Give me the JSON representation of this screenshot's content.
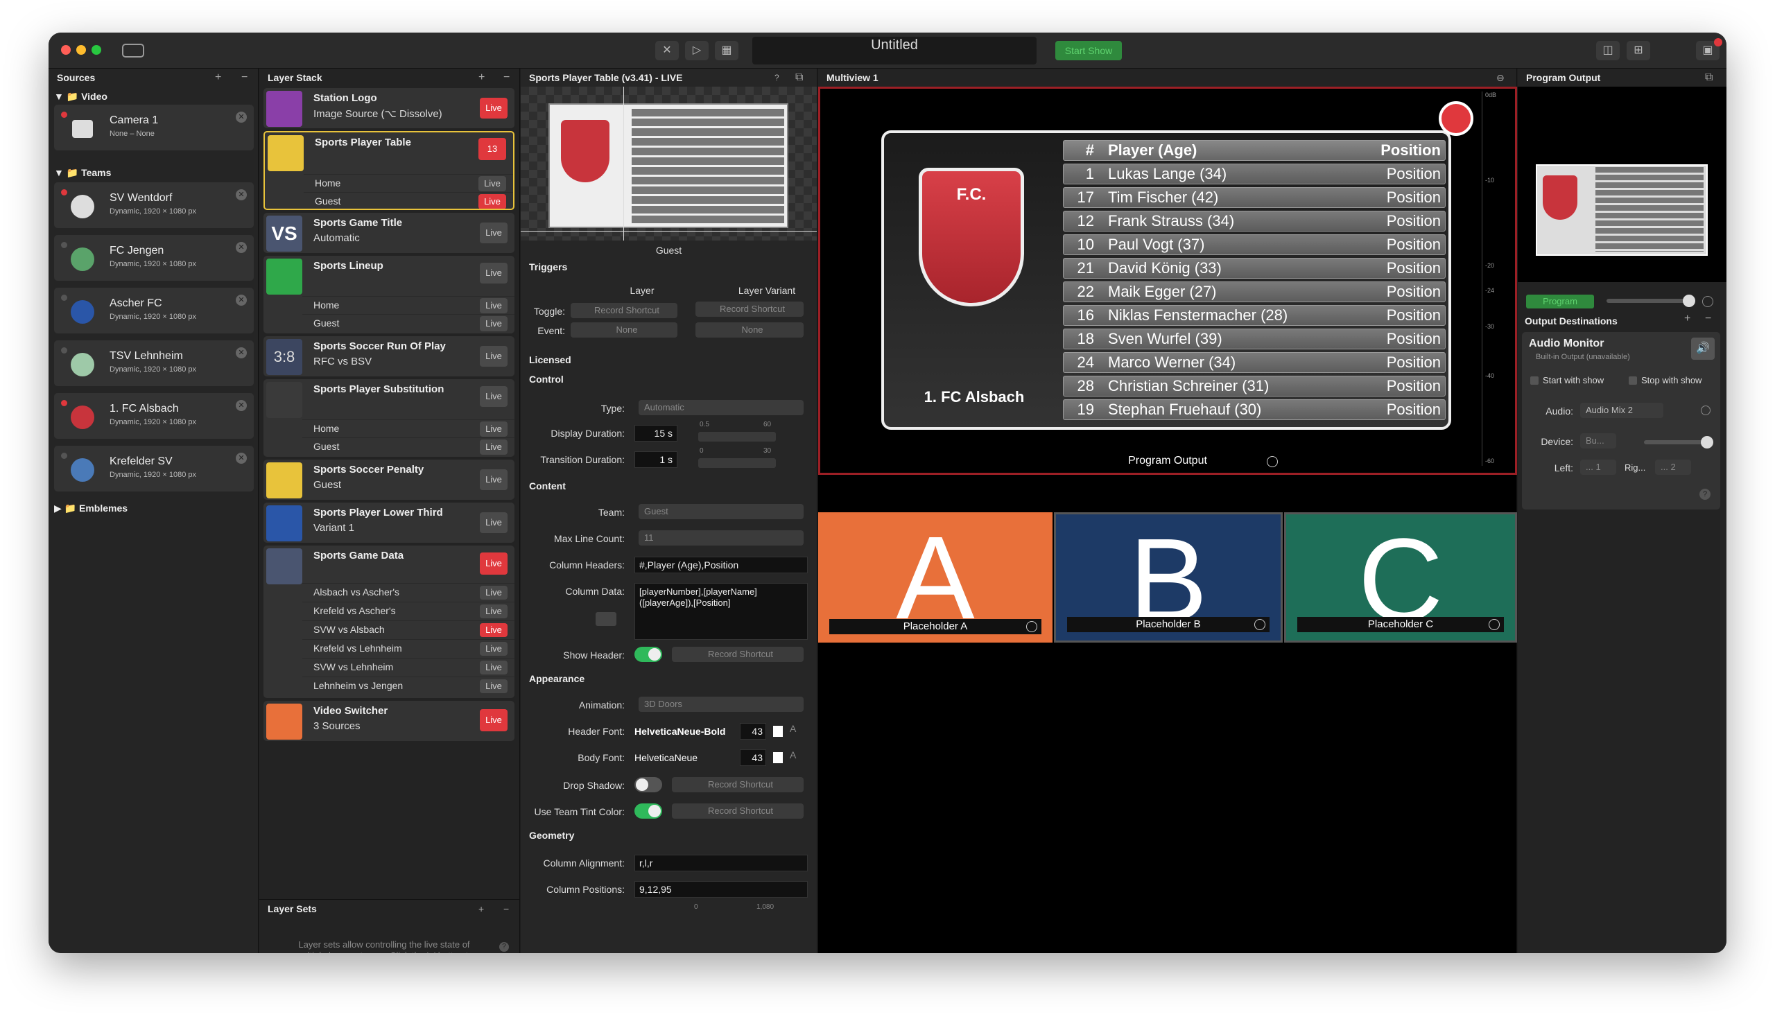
{
  "window": {
    "title": "Untitled",
    "start_show": "Start Show"
  },
  "sources": {
    "header": "Sources",
    "groups": {
      "video": "Video",
      "teams": "Teams",
      "emblemes": "Emblemes"
    },
    "items": [
      {
        "name": "Camera 1",
        "sub": "None – None"
      },
      {
        "name": "SV Wentdorf",
        "sub": "Dynamic, 1920 × 1080 px"
      },
      {
        "name": "FC Jengen",
        "sub": "Dynamic, 1920 × 1080 px"
      },
      {
        "name": "Ascher FC",
        "sub": "Dynamic, 1920 × 1080 px"
      },
      {
        "name": "TSV Lehnheim",
        "sub": "Dynamic, 1920 × 1080 px"
      },
      {
        "name": "1. FC Alsbach",
        "sub": "Dynamic, 1920 × 1080 px"
      },
      {
        "name": "Krefelder SV",
        "sub": "Dynamic, 1920 × 1080 px"
      }
    ]
  },
  "layers": {
    "header": "Layer Stack",
    "live": "Live",
    "items": [
      {
        "name": "Station Logo",
        "sub": "Image Source (⌥ Dissolve)"
      },
      {
        "name": "Sports Player Table",
        "badge": "13",
        "variants": [
          "Home",
          "Guest"
        ]
      },
      {
        "name": "Sports Game Title",
        "sub": "Automatic"
      },
      {
        "name": "Sports Lineup",
        "variants": [
          "Home",
          "Guest"
        ]
      },
      {
        "name": "Sports Soccer Run Of Play",
        "sub": "RFC vs BSV"
      },
      {
        "name": "Sports Player Substitution",
        "variants": [
          "Home",
          "Guest"
        ]
      },
      {
        "name": "Sports Soccer Penalty",
        "sub": "Guest"
      },
      {
        "name": "Sports Player Lower Third",
        "sub": "Variant 1"
      },
      {
        "name": "Sports Game Data",
        "variants": [
          "Alsbach vs Ascher's",
          "Krefeld vs Ascher's",
          "SVW vs Alsbach",
          "Krefeld vs Lehnheim",
          "SVW vs Lehnheim",
          "Lehnheim vs Jengen"
        ]
      },
      {
        "name": "Video Switcher",
        "sub": "3 Sources"
      }
    ],
    "layer_sets_header": "Layer Sets",
    "layer_sets_help": "Layer sets allow controlling the live state of multiple layers at once. Click the '+' button to capture the current layer stack in a new layer set."
  },
  "inspector": {
    "header": "Sports Player Table (v3.41) - LIVE",
    "variant": "Guest",
    "triggers": "Triggers",
    "layer": "Layer",
    "layer_variant": "Layer Variant",
    "toggle_label": "Toggle:",
    "event_label": "Event:",
    "record_shortcut": "Record Shortcut",
    "none": "None",
    "licensed": "Licensed",
    "control": "Control",
    "type_label": "Type:",
    "type_value": "Automatic",
    "display_duration_label": "Display Duration:",
    "display_duration": "15 s",
    "transition_duration_label": "Transition Duration:",
    "transition_duration": "1 s",
    "content": "Content",
    "team_label": "Team:",
    "team_value": "Guest",
    "max_line_label": "Max Line Count:",
    "max_line_value": "11",
    "col_headers_label": "Column Headers:",
    "col_headers": "#,Player (Age),Position",
    "col_data_label": "Column Data:",
    "col_data": "[playerNumber],[playerName] ([playerAge]),[Position]",
    "show_header_label": "Show Header:",
    "appearance": "Appearance",
    "animation_label": "Animation:",
    "animation_value": "3D Doors",
    "header_font_label": "Header Font:",
    "header_font": "HelveticaNeue-Bold",
    "body_font_label": "Body Font:",
    "body_font": "HelveticaNeue",
    "font_size": "43",
    "drop_shadow_label": "Drop Shadow:",
    "tint_label": "Use Team Tint Color:",
    "geometry": "Geometry",
    "col_align_label": "Column Alignment:",
    "col_align": "r,l,r",
    "col_pos_label": "Column Positions:",
    "col_pos": "9,12,95",
    "slider_marks": {
      "d1": "0.5",
      "d2": "60",
      "t1": "0",
      "t2": "30",
      "g1": "0",
      "g2": "1,080"
    }
  },
  "multiview": {
    "header": "Multiview 1",
    "program_output": "Program Output",
    "team": "1. FC Alsbach",
    "fc_label": "F.C.",
    "table_header": {
      "num": "#",
      "player": "Player (Age)",
      "position": "Position"
    },
    "rows": [
      {
        "num": "1",
        "player": "Lukas Lange (34)",
        "position": "Position"
      },
      {
        "num": "17",
        "player": "Tim Fischer (42)",
        "position": "Position"
      },
      {
        "num": "12",
        "player": "Frank Strauss (34)",
        "position": "Position"
      },
      {
        "num": "10",
        "player": "Paul Vogt (37)",
        "position": "Position"
      },
      {
        "num": "21",
        "player": "David König (33)",
        "position": "Position"
      },
      {
        "num": "22",
        "player": "Maik Egger (27)",
        "position": "Position"
      },
      {
        "num": "16",
        "player": "Niklas Fenstermacher (28)",
        "position": "Position"
      },
      {
        "num": "18",
        "player": "Sven Wurfel (39)",
        "position": "Position"
      },
      {
        "num": "24",
        "player": "Marco Werner (34)",
        "position": "Position"
      },
      {
        "num": "28",
        "player": "Christian Schreiner (31)",
        "position": "Position"
      },
      {
        "num": "19",
        "player": "Stephan Fruehauf (30)",
        "position": "Position"
      }
    ],
    "meter_labels": [
      "0dB",
      "-10",
      "-20",
      "-24",
      "-30",
      "-40",
      "-60"
    ],
    "placeholders": [
      {
        "letter": "A",
        "label": "Placeholder A",
        "color": "#e8703a"
      },
      {
        "letter": "B",
        "label": "Placeholder B",
        "color": "#1d3a66"
      },
      {
        "letter": "C",
        "label": "Placeholder C",
        "color": "#1e6e58"
      }
    ]
  },
  "program": {
    "header": "Program Output",
    "program_btn": "Program",
    "dest_header": "Output Destinations",
    "audio_monitor": "Audio Monitor",
    "audio_sub": "Built-in Output (unavailable)",
    "start_with_show": "Start with show",
    "stop_with_show": "Stop with show",
    "audio_label": "Audio:",
    "audio_value": "Audio Mix 2",
    "device_label": "Device:",
    "device_value": "Bu...",
    "left_label": "Left:",
    "left_value": "... 1",
    "right_label": "Rig...",
    "right_value": "... 2"
  }
}
